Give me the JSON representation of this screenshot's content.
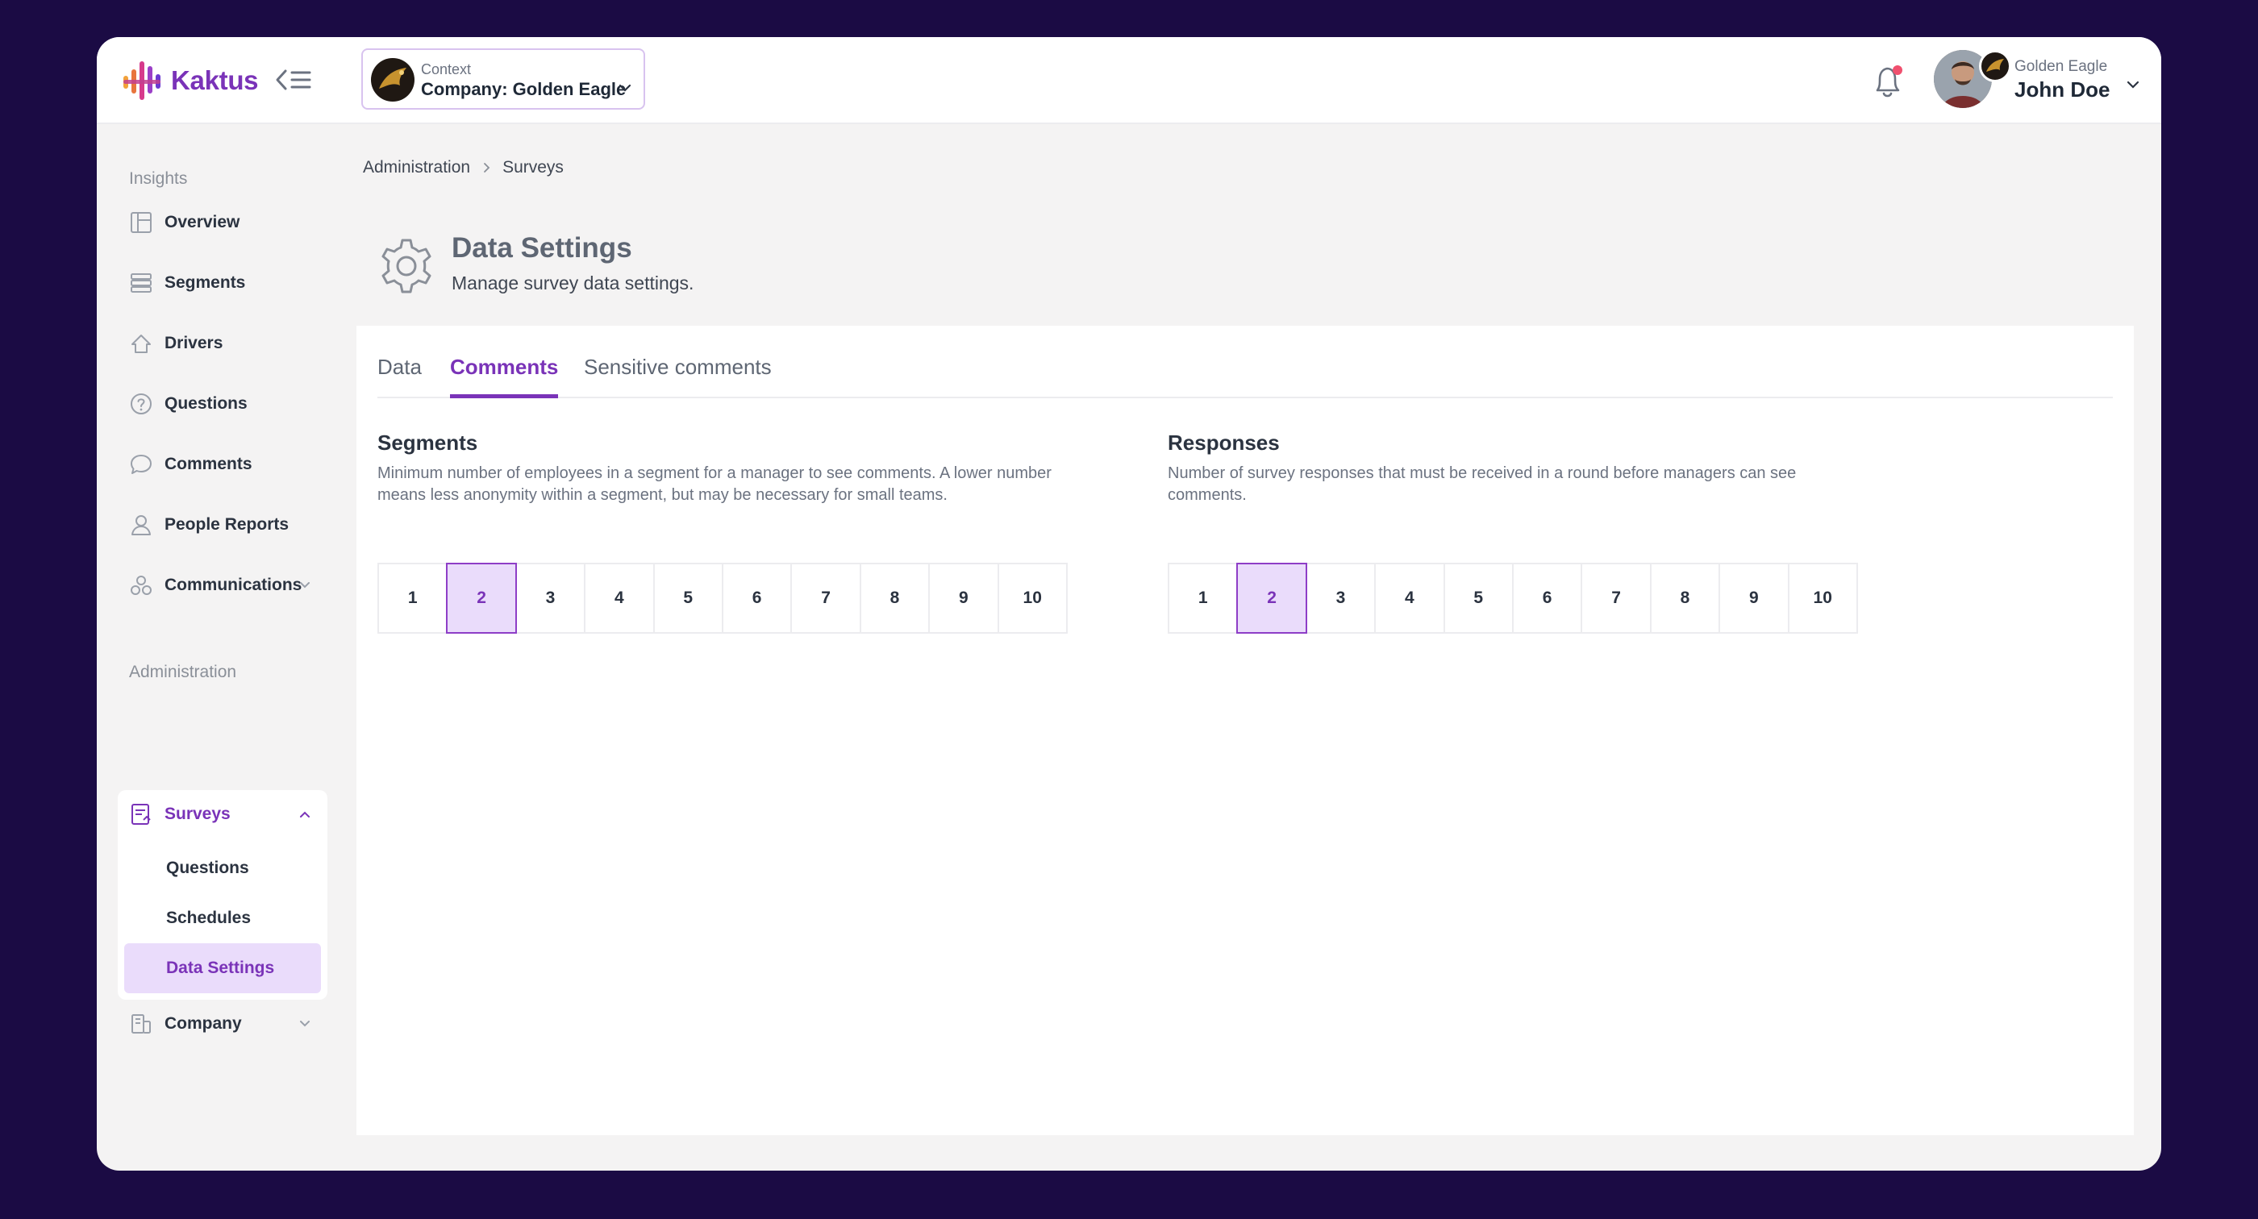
{
  "app": {
    "name": "Kaktus",
    "brand_color": "#7a33b8"
  },
  "context": {
    "label": "Context",
    "value": "Company: Golden Eagle"
  },
  "user": {
    "company": "Golden Eagle",
    "name": "John Doe"
  },
  "notifications": {
    "has_unread": true,
    "dot_color": "#f0506e"
  },
  "sidebar": {
    "insights_title": "Insights",
    "insights": [
      {
        "label": "Overview",
        "icon": "overview-icon"
      },
      {
        "label": "Segments",
        "icon": "segments-icon"
      },
      {
        "label": "Drivers",
        "icon": "drivers-icon"
      },
      {
        "label": "Questions",
        "icon": "question-icon"
      },
      {
        "label": "Comments",
        "icon": "comment-icon"
      },
      {
        "label": "People Reports",
        "icon": "person-icon"
      },
      {
        "label": "Communications",
        "icon": "communications-icon"
      }
    ],
    "admin_title": "Administration",
    "surveys": {
      "label": "Surveys",
      "children": [
        {
          "label": "Questions"
        },
        {
          "label": "Schedules"
        },
        {
          "label": "Data Settings",
          "active": true
        }
      ]
    },
    "company": {
      "label": "Company"
    }
  },
  "breadcrumb": [
    "Administration",
    "Surveys"
  ],
  "page": {
    "title": "Data Settings",
    "subtitle": "Manage survey data settings."
  },
  "tabs": [
    {
      "label": "Data",
      "active": false
    },
    {
      "label": "Comments",
      "active": true
    },
    {
      "label": "Sensitive comments",
      "active": false
    }
  ],
  "settings": {
    "segments": {
      "title": "Segments",
      "description": "Minimum number of employees in a segment for a manager to see comments. A lower number means less anonymity within a segment, but may be necessary for small teams.",
      "options": [
        "1",
        "2",
        "3",
        "4",
        "5",
        "6",
        "7",
        "8",
        "9",
        "10"
      ],
      "selected": "2"
    },
    "responses": {
      "title": "Responses",
      "description": "Number of survey responses that must be received in a round before managers can see comments.",
      "options": [
        "1",
        "2",
        "3",
        "4",
        "5",
        "6",
        "7",
        "8",
        "9",
        "10"
      ],
      "selected": "2"
    }
  }
}
